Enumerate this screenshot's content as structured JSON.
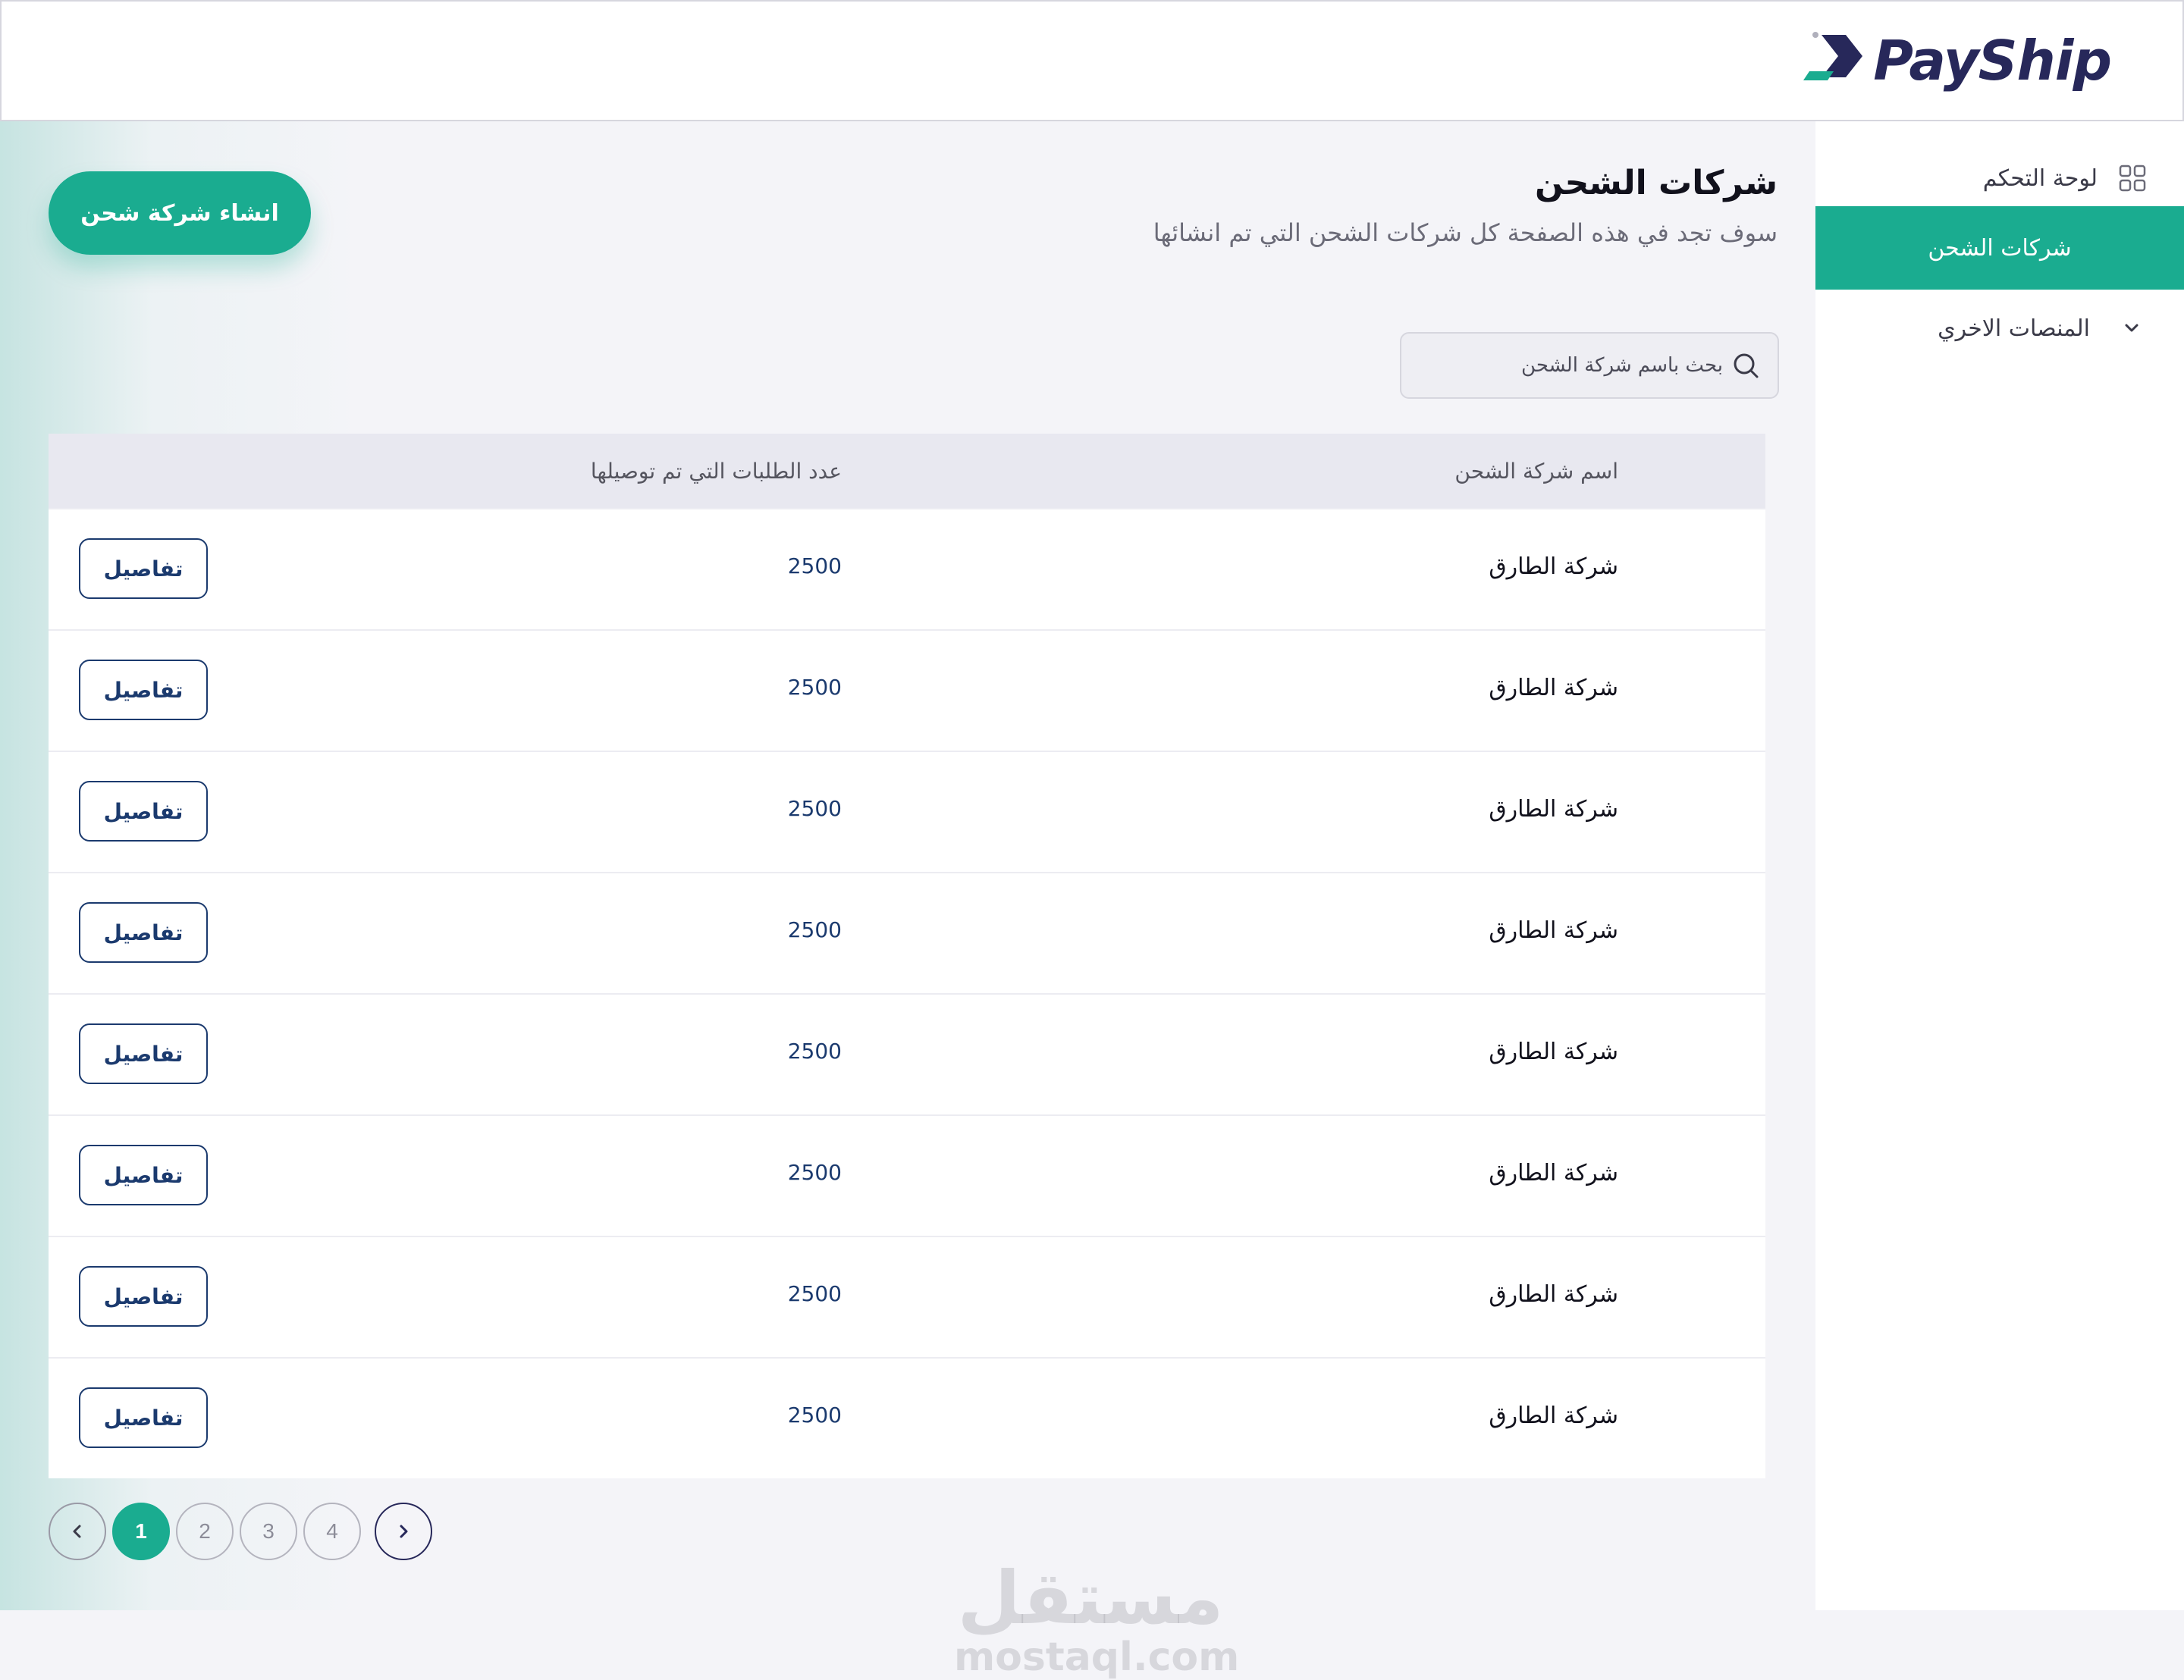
{
  "brand": {
    "name": "PayShip",
    "colors": {
      "primary": "#1aac90",
      "navy": "#27285a",
      "text_blue": "#1b3a6e"
    }
  },
  "sidebar": {
    "items": [
      {
        "label": "لوحة التحكم",
        "icon": "grid-icon",
        "active": false
      },
      {
        "label": "شركات الشحن",
        "icon": "",
        "active": true
      },
      {
        "label": "المنصات الاخري",
        "icon": "chevron-down-icon",
        "active": false
      }
    ]
  },
  "page": {
    "title": "شركات الشحن",
    "subtitle": "سوف تجد في هذه الصفحة كل شركات الشحن التي تم انشائها",
    "create_button": "انشاء شركة شحن"
  },
  "search": {
    "placeholder": "بحث باسم شركة الشحن",
    "value": ""
  },
  "table": {
    "columns": [
      "اسم شركة الشحن",
      "عدد الطلبات التي تم توصيلها"
    ],
    "details_label": "تفاصيل",
    "rows": [
      {
        "name": "شركة الطارق",
        "count": "2500"
      },
      {
        "name": "شركة الطارق",
        "count": "2500"
      },
      {
        "name": "شركة الطارق",
        "count": "2500"
      },
      {
        "name": "شركة الطارق",
        "count": "2500"
      },
      {
        "name": "شركة الطارق",
        "count": "2500"
      },
      {
        "name": "شركة الطارق",
        "count": "2500"
      },
      {
        "name": "شركة الطارق",
        "count": "2500"
      },
      {
        "name": "شركة الطارق",
        "count": "2500"
      }
    ]
  },
  "pagination": {
    "pages": [
      "1",
      "2",
      "3",
      "4"
    ],
    "current": "1"
  },
  "watermark": {
    "arabic": "مستقل",
    "latin": "mostaql.com"
  }
}
